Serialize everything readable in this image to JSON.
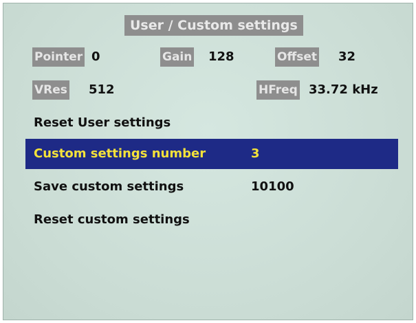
{
  "menu": {
    "title": "User / Custom settings",
    "status": {
      "pointer": {
        "label": "Pointer",
        "value": "0"
      },
      "gain": {
        "label": "Gain",
        "value": "128"
      },
      "offset": {
        "label": "Offset",
        "value": "32"
      },
      "vres": {
        "label": "VRes",
        "value": "512"
      },
      "hfreq": {
        "label": "HFreq",
        "value": "33.72 kHz"
      }
    },
    "items": [
      {
        "label": "Reset User settings",
        "value": ""
      },
      {
        "label": "Custom settings number",
        "value": "3",
        "selected": true
      },
      {
        "label": "Save custom settings",
        "value": "10100"
      },
      {
        "label": "Reset custom settings",
        "value": ""
      }
    ]
  },
  "colors": {
    "background": "#cde0d8",
    "tag_background": "#8e8e8e",
    "selection_background": "#1e2a86",
    "selection_text": "#f4e23a"
  }
}
